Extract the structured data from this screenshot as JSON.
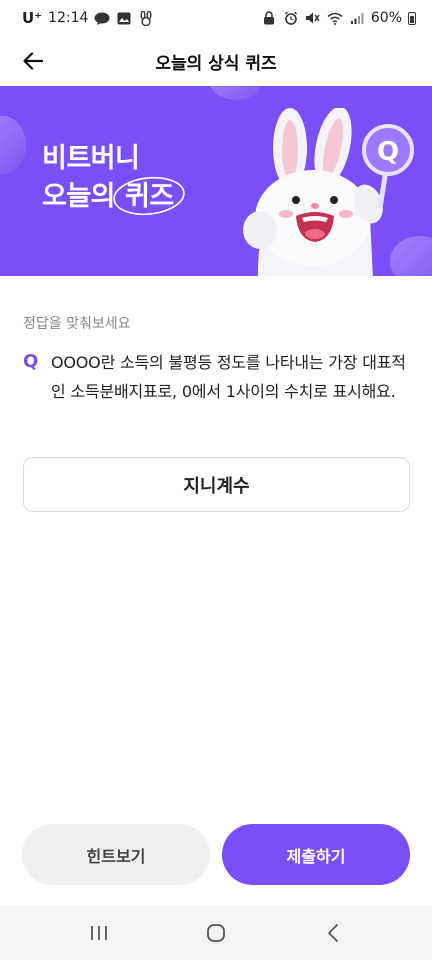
{
  "status_bar": {
    "carrier": "U⁺",
    "time": "12:14",
    "battery": "60%"
  },
  "app_bar": {
    "title": "오늘의 상식 퀴즈"
  },
  "banner": {
    "line1": "비트버니",
    "line2_prefix": "오늘의",
    "line2_highlight": "퀴즈",
    "badge": "Q"
  },
  "quiz": {
    "instruction": "정답을 맞춰보세요",
    "question_mark": "Q",
    "question_text": "OOOO란 소득의 불평등 정도를 나타내는 가장 대표적인 소득분배지표로, 0에서 1사이의 수치로 표시해요.",
    "answer_value": "지니계수"
  },
  "buttons": {
    "hint_label": "힌트보기",
    "submit_label": "제출하기"
  },
  "colors": {
    "accent": "#7b4ff7",
    "hint_bg": "#f0f0f2",
    "nav_bg": "#f4f4f4"
  }
}
